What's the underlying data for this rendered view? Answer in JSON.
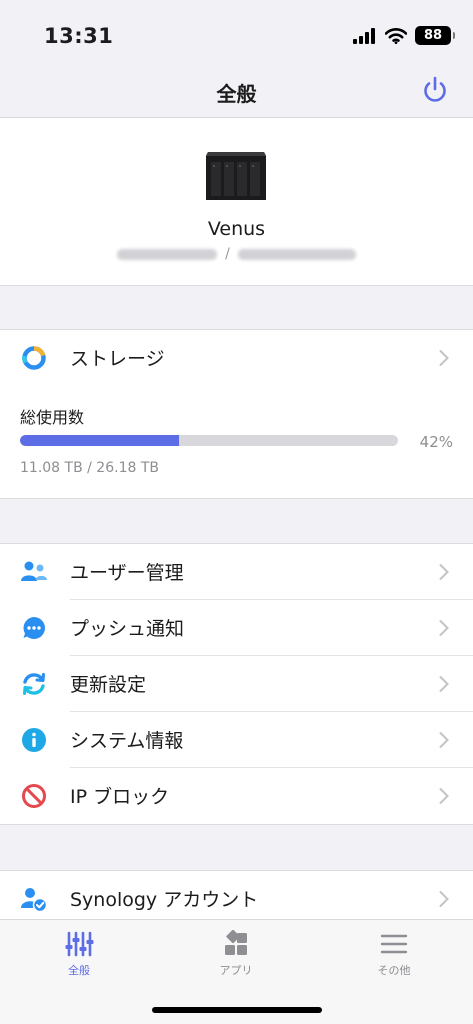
{
  "status_bar": {
    "time": "13:31",
    "battery": "88"
  },
  "nav": {
    "title": "全般",
    "power_icon": "power-icon"
  },
  "device": {
    "name": "Venus",
    "separator": "/"
  },
  "storage": {
    "label": "ストレージ",
    "usage_label": "総使用数",
    "percent_text": "42%",
    "percent_value": 0.42,
    "usage_detail": "11.08 TB / 26.18 TB"
  },
  "menu": {
    "items": [
      {
        "label": "ユーザー管理",
        "icon": "users-icon"
      },
      {
        "label": "プッシュ通知",
        "icon": "chat-bubble-icon"
      },
      {
        "label": "更新設定",
        "icon": "refresh-icon"
      },
      {
        "label": "システム情報",
        "icon": "info-icon"
      },
      {
        "label": "IP ブロック",
        "icon": "block-icon"
      }
    ]
  },
  "account": {
    "label": "Synology アカウント"
  },
  "tabs": [
    {
      "label": "全般",
      "active": true
    },
    {
      "label": "アプリ",
      "active": false
    },
    {
      "label": "その他",
      "active": false
    }
  ],
  "colors": {
    "accent": "#5d6de6",
    "blue": "#2a8ff0",
    "red": "#e5484d",
    "cyan": "#1fa8e6"
  }
}
